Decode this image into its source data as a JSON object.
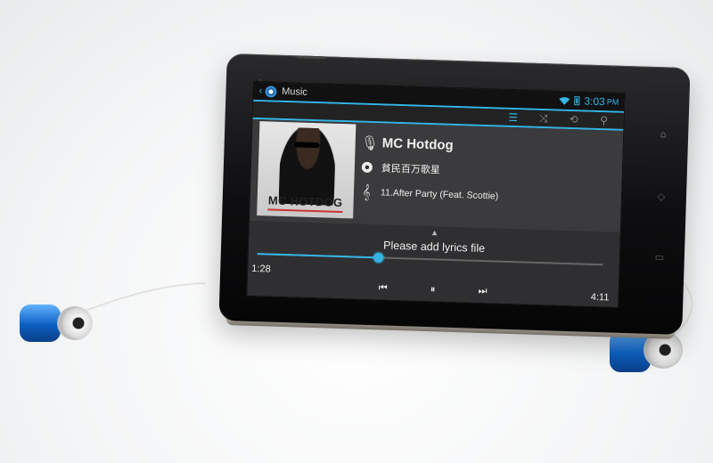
{
  "status_bar": {
    "time": "3:03",
    "ampm": "PM"
  },
  "app_bar": {
    "back_icon": "chevron-left-icon",
    "app_icon": "music-app-icon",
    "title": "Music"
  },
  "action_bar": {
    "icons": [
      "list-icon",
      "shuffle-icon",
      "repeat-icon",
      "search-icon"
    ],
    "active": "list-icon",
    "accent": "#33b5e5"
  },
  "album_art": {
    "text": "MC HOTDOG"
  },
  "now_playing": {
    "artist": "MC Hotdog",
    "album": "貧民百万歌星",
    "track": "11.After Party (Feat. Scottie)"
  },
  "lyrics": {
    "message": "Please add lyrics file"
  },
  "player": {
    "current_time": "1:28",
    "duration": "4:11",
    "progress": 0.35,
    "buttons": [
      "previous-icon",
      "pause-icon",
      "next-icon"
    ]
  }
}
